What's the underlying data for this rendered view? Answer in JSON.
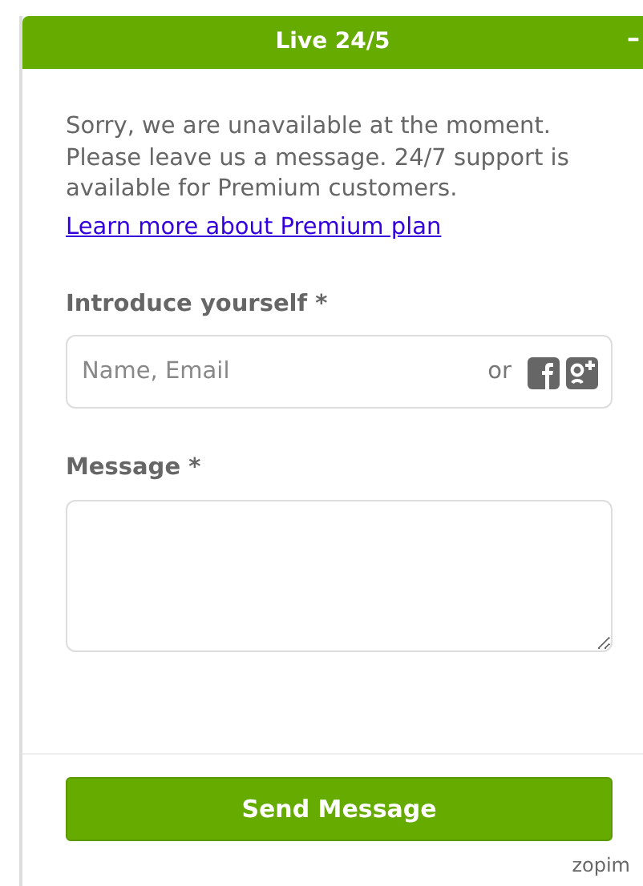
{
  "header": {
    "title": "Live 24/5",
    "minimize": "–"
  },
  "notice": {
    "text": "Sorry, we are unavailable at the moment. Please leave us a message. 24/7 support is available for Premium customers.",
    "link": "Learn more about Premium plan"
  },
  "introduce": {
    "label": "Introduce yourself *",
    "placeholder": "Name, Email",
    "or": "or"
  },
  "message": {
    "label": "Message *"
  },
  "send_button": "Send Message",
  "branding": "zopim"
}
